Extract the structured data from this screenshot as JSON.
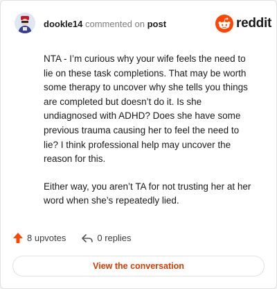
{
  "header": {
    "username": "dookle14",
    "action_text": "commented on",
    "target": "post",
    "brand": "reddit"
  },
  "comment": {
    "paragraphs": [
      "NTA - I’m curious why your wife feels the need to lie on these task completions. That may be worth some therapy to uncover why she tells you things are completed but doesn’t do it. Is she undiagnosed with ADHD? Does she have some previous trauma causing her to feel the need to lie? I think professional help may uncover the reason for this.",
      "Either way, you aren’t TA for not trusting her at her word when she’s repeatedly lied."
    ]
  },
  "actions": {
    "upvotes_label": "8 upvotes",
    "replies_label": "0 replies"
  },
  "cta": {
    "label": "View the conversation"
  },
  "colors": {
    "accent": "#d93a00",
    "upvote": "#ff4500",
    "reddit_orange": "#ff4500"
  },
  "icons": [
    "user-avatar",
    "reddit-snoo-icon",
    "upvote-arrow-icon",
    "reply-arrow-icon"
  ]
}
